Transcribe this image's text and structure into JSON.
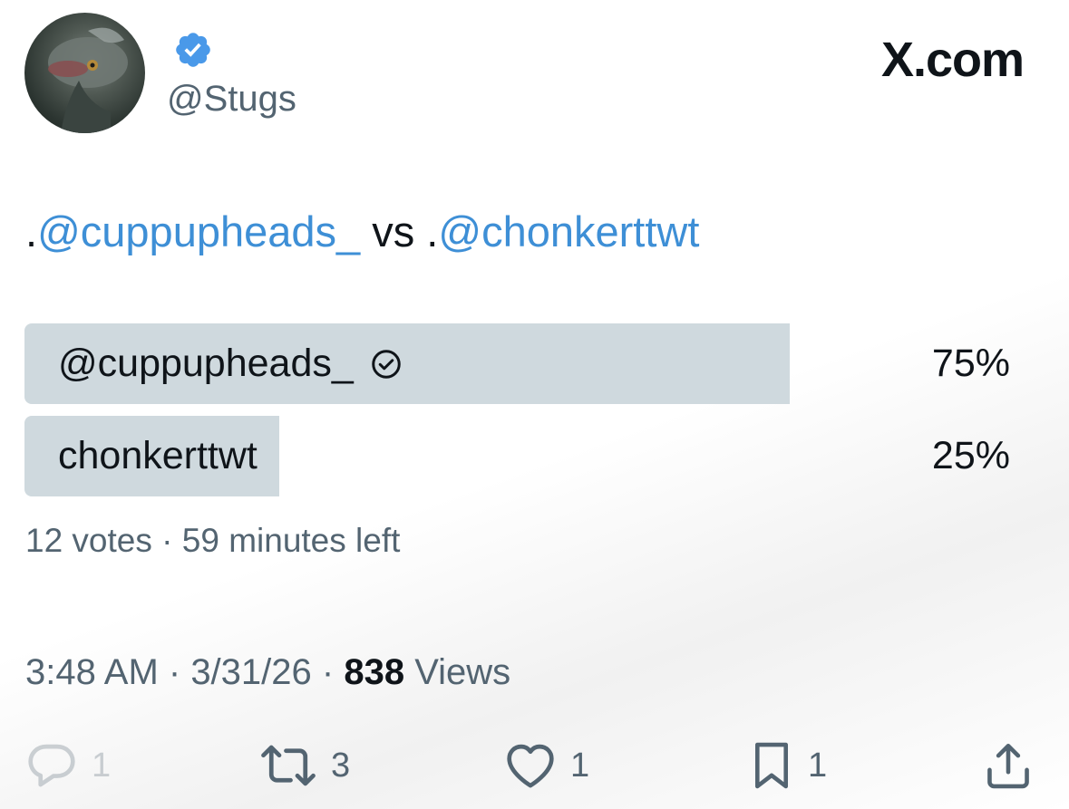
{
  "author": {
    "handle": "@Stugs",
    "verified": true,
    "badge_color": "#4a99e9"
  },
  "brand": "X.com",
  "tweet": {
    "prefix1": ".",
    "mention1": "@cuppupheads_",
    "middle": " vs .",
    "mention2": "@chonkerttwt",
    "mention_color": "#3e8fd6"
  },
  "poll": {
    "options": [
      {
        "label": "@cuppupheads_",
        "percent_label": "75%",
        "percent": 75,
        "selected": true
      },
      {
        "label": "chonkerttwt",
        "percent_label": "25%",
        "percent": 25,
        "selected": false
      }
    ],
    "votes": "12 votes",
    "separator": " · ",
    "time_left": "59 minutes left",
    "bar_color": "#cfd9de"
  },
  "timestamp": {
    "time": "3:48 AM",
    "date": "3/31/26",
    "views_count": "838",
    "views_label": " Views",
    "separator": " · "
  },
  "actions": {
    "reply": {
      "icon": "reply-icon",
      "count": "1"
    },
    "retweet": {
      "icon": "retweet-icon",
      "count": "3"
    },
    "like": {
      "icon": "heart-icon",
      "count": "1"
    },
    "bookmark": {
      "icon": "bookmark-icon",
      "count": "1"
    },
    "share": {
      "icon": "share-icon"
    }
  }
}
